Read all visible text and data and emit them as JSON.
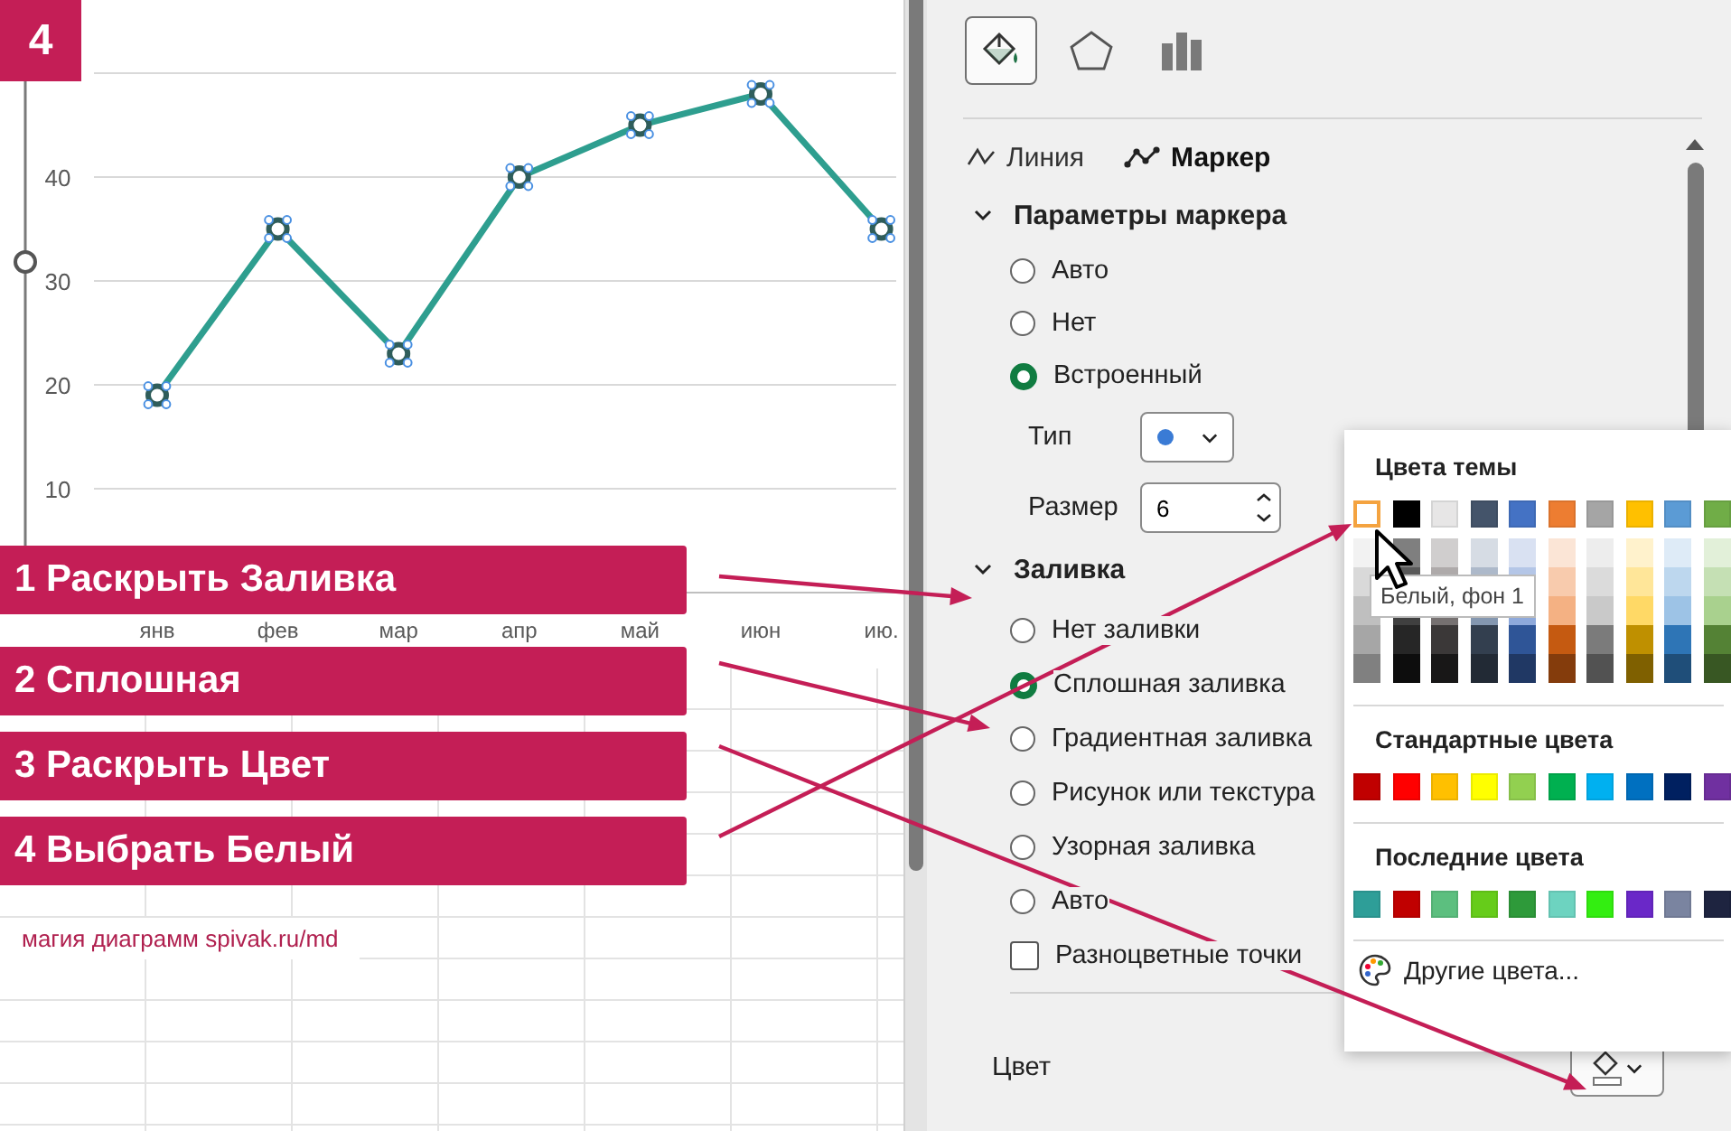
{
  "step_badge": "4",
  "chart": {
    "chart_data": {
      "type": "line",
      "categories": [
        "янв",
        "фев",
        "мар",
        "апр",
        "май",
        "июн",
        "ию."
      ],
      "series": [
        {
          "color": "#2e9e8f",
          "marker": "circle",
          "values": [
            19,
            35,
            23,
            40,
            45,
            48,
            35
          ]
        }
      ],
      "ylim": [
        0,
        50
      ],
      "yticks": [
        10,
        20,
        30,
        40
      ],
      "grid": true
    }
  },
  "steps": [
    "1 Раскрыть Заливка",
    "2 Сплошная",
    "3 Раскрыть Цвет",
    "4 Выбрать Белый"
  ],
  "credit": "магия диаграмм spivak.ru/md",
  "panel": {
    "tabs": [
      {
        "kind": "fill",
        "selected": true
      },
      {
        "kind": "effects",
        "selected": false
      },
      {
        "kind": "series",
        "selected": false
      }
    ],
    "subtabs": [
      {
        "kind": "line",
        "label": "Линия",
        "selected": false
      },
      {
        "kind": "marker",
        "label": "Маркер",
        "selected": true
      }
    ],
    "marker_section": {
      "title": "Параметры маркера",
      "expanded": true,
      "options": [
        {
          "label": "Авто",
          "selected": false
        },
        {
          "label": "Нет",
          "selected": false
        },
        {
          "label": "Встроенный",
          "selected": true
        }
      ],
      "type_label": "Тип",
      "size_label": "Размер",
      "size_value": "6"
    },
    "fill_section": {
      "title": "Заливка",
      "expanded": true,
      "options": [
        {
          "label": "Нет заливки",
          "selected": false
        },
        {
          "label": "Сплошная заливка",
          "selected": true
        },
        {
          "label": "Градиентная заливка",
          "selected": false
        },
        {
          "label": "Рисунок или текстура",
          "selected": false
        },
        {
          "label": "Узорная заливка",
          "selected": false
        },
        {
          "label": "Авто",
          "selected": false
        }
      ],
      "checkbox": {
        "label": "Разноцветные точки",
        "checked": false
      },
      "color_label": "Цвет"
    }
  },
  "color_popup": {
    "theme_title": "Цвета темы",
    "theme_colors": [
      {
        "color": "#ffffff",
        "selected": true,
        "shades": [
          {
            "color": "#f2f2f2"
          },
          {
            "color": "#d9d9d9"
          },
          {
            "color": "#bfbfbf"
          },
          {
            "color": "#a6a6a6"
          },
          {
            "color": "#808080"
          }
        ]
      },
      {
        "color": "#000000",
        "selected": false,
        "shades": [
          {
            "color": "#7f7f7f"
          },
          {
            "color": "#595959"
          },
          {
            "color": "#404040"
          },
          {
            "color": "#262626"
          },
          {
            "color": "#0d0d0d"
          }
        ]
      },
      {
        "color": "#e7e6e6",
        "selected": false,
        "shades": [
          {
            "color": "#d0cece"
          },
          {
            "color": "#aeaaaa"
          },
          {
            "color": "#767171"
          },
          {
            "color": "#3b3838"
          },
          {
            "color": "#181717"
          }
        ]
      },
      {
        "color": "#44546a",
        "selected": false,
        "shades": [
          {
            "color": "#d6dce4"
          },
          {
            "color": "#adb9ca"
          },
          {
            "color": "#8497b0"
          },
          {
            "color": "#333f4f"
          },
          {
            "color": "#222a35"
          }
        ]
      },
      {
        "color": "#4472c4",
        "selected": false,
        "shades": [
          {
            "color": "#d9e1f2"
          },
          {
            "color": "#b4c6e7"
          },
          {
            "color": "#8ea9db"
          },
          {
            "color": "#2f5597"
          },
          {
            "color": "#203864"
          }
        ]
      },
      {
        "color": "#ed7d31",
        "selected": false,
        "shades": [
          {
            "color": "#fbe5d6"
          },
          {
            "color": "#f8cbad"
          },
          {
            "color": "#f4b183"
          },
          {
            "color": "#c55a11"
          },
          {
            "color": "#843c0c"
          }
        ]
      },
      {
        "color": "#a5a5a5",
        "selected": false,
        "shades": [
          {
            "color": "#ededed"
          },
          {
            "color": "#dbdbdb"
          },
          {
            "color": "#c9c9c9"
          },
          {
            "color": "#7b7b7b"
          },
          {
            "color": "#525252"
          }
        ]
      },
      {
        "color": "#ffc000",
        "selected": false,
        "shades": [
          {
            "color": "#fff2cc"
          },
          {
            "color": "#ffe699"
          },
          {
            "color": "#ffd966"
          },
          {
            "color": "#bf9000"
          },
          {
            "color": "#7f6000"
          }
        ]
      },
      {
        "color": "#5b9bd5",
        "selected": false,
        "shades": [
          {
            "color": "#deebf7"
          },
          {
            "color": "#bdd7ee"
          },
          {
            "color": "#9dc3e6"
          },
          {
            "color": "#2e75b6"
          },
          {
            "color": "#1f4e79"
          }
        ]
      },
      {
        "color": "#70ad47",
        "selected": false,
        "shades": [
          {
            "color": "#e2f0d9"
          },
          {
            "color": "#c5e0b4"
          },
          {
            "color": "#a9d18e"
          },
          {
            "color": "#548235"
          },
          {
            "color": "#385723"
          }
        ]
      }
    ],
    "tooltip": "Белый, фон 1",
    "standard_title": "Стандартные цвета",
    "standard_colors": [
      {
        "color": "#c00000"
      },
      {
        "color": "#ff0000"
      },
      {
        "color": "#ffc000"
      },
      {
        "color": "#ffff00"
      },
      {
        "color": "#92d050"
      },
      {
        "color": "#00b050"
      },
      {
        "color": "#00b0f0"
      },
      {
        "color": "#0070c0"
      },
      {
        "color": "#002060"
      },
      {
        "color": "#7030a0"
      }
    ],
    "recent_title": "Последние цвета",
    "recent_colors": [
      {
        "color": "#2e9e98"
      },
      {
        "color": "#c00000"
      },
      {
        "color": "#5cbf7f"
      },
      {
        "color": "#66cc1a"
      },
      {
        "color": "#2e9a3a"
      },
      {
        "color": "#6dd3c0"
      },
      {
        "color": "#33ee11"
      },
      {
        "color": "#6a28c8"
      },
      {
        "color": "#7a84a0"
      },
      {
        "color": "#1e2440"
      }
    ],
    "more_label": "Другие цвета..."
  }
}
